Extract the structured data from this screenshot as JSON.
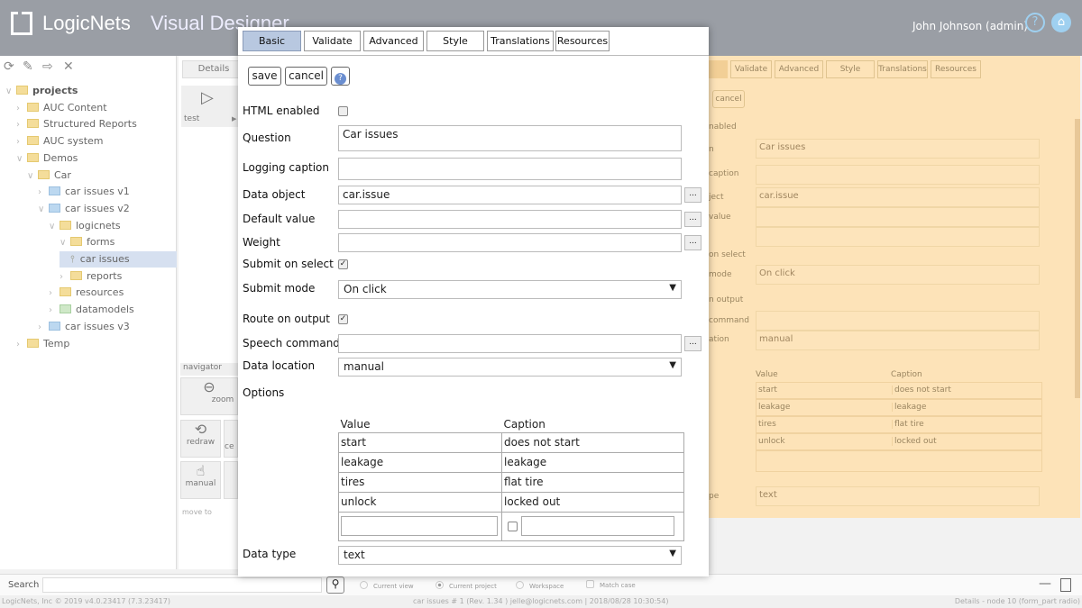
{
  "header": {
    "brand": "LogicNets",
    "subtitle": "Visual Designer",
    "user": "John Johnson (admin)",
    "help_icon": "?",
    "home_icon": "⌂"
  },
  "sidebar": {
    "toolbar_icons": [
      "refresh-icon",
      "edit-icon",
      "export-icon",
      "close-icon"
    ],
    "tree": [
      {
        "label": "projects",
        "level": 0,
        "open": true,
        "color": "yellow",
        "bold": true
      },
      {
        "label": "AUC Content",
        "level": 1,
        "open": false,
        "color": "yellow"
      },
      {
        "label": "Structured Reports",
        "level": 1,
        "open": false,
        "color": "yellow"
      },
      {
        "label": "AUC system",
        "level": 1,
        "open": false,
        "color": "yellow"
      },
      {
        "label": "Demos",
        "level": 1,
        "open": true,
        "color": "yellow"
      },
      {
        "label": "Car",
        "level": 2,
        "open": true,
        "color": "yellow"
      },
      {
        "label": "car issues v1",
        "level": 3,
        "open": false,
        "color": "blue"
      },
      {
        "label": "car issues v2",
        "level": 3,
        "open": true,
        "color": "blue"
      },
      {
        "label": "logicnets",
        "level": 4,
        "open": true,
        "color": "yellow"
      },
      {
        "label": "forms",
        "level": 5,
        "open": true,
        "color": "yellow"
      },
      {
        "label": "car issues",
        "level": 5,
        "leaf": true,
        "selected": true
      },
      {
        "label": "reports",
        "level": 5,
        "open": false,
        "color": "yellow"
      },
      {
        "label": "resources",
        "level": 4,
        "open": false,
        "color": "yellow"
      },
      {
        "label": "datamodels",
        "level": 4,
        "open": false,
        "color": "green"
      },
      {
        "label": "car issues v3",
        "level": 3,
        "open": false,
        "color": "blue"
      },
      {
        "label": "Temp",
        "level": 1,
        "open": false,
        "color": "yellow"
      }
    ]
  },
  "middle": {
    "details_tab": "Details",
    "node_label": "test",
    "navigator": "navigator",
    "zoom": "zoom",
    "redraw": "redraw",
    "center_partial": "ce",
    "manual": "manual",
    "move_to": "move to"
  },
  "dialog": {
    "tabs": [
      "Basic",
      "Validate",
      "Advanced",
      "Style",
      "Translations",
      "Resources"
    ],
    "active_tab": "Basic",
    "save": "save",
    "cancel": "cancel",
    "help": "?",
    "fields": {
      "html_enabled": {
        "label": "HTML enabled",
        "checked": false
      },
      "question": {
        "label": "Question",
        "value": "Car issues"
      },
      "logging_caption": {
        "label": "Logging caption",
        "value": ""
      },
      "data_object": {
        "label": "Data object",
        "value": "car.issue"
      },
      "default_value": {
        "label": "Default value",
        "value": ""
      },
      "weight": {
        "label": "Weight",
        "value": ""
      },
      "submit_on_select": {
        "label": "Submit on select",
        "checked": true
      },
      "submit_mode": {
        "label": "Submit mode",
        "value": "On click"
      },
      "route_on_output": {
        "label": "Route on output",
        "checked": true
      },
      "speech_command": {
        "label": "Speech command",
        "value": ""
      },
      "data_location": {
        "label": "Data location",
        "value": "manual"
      },
      "options": {
        "label": "Options",
        "headers": [
          "Value",
          "Caption"
        ],
        "rows": [
          [
            "start",
            "does not start"
          ],
          [
            "leakage",
            "leakage"
          ],
          [
            "tires",
            "flat tire"
          ],
          [
            "unlock",
            "locked out"
          ]
        ]
      },
      "data_type": {
        "label": "Data type",
        "value": "text"
      }
    },
    "dots": "..."
  },
  "background_panel": {
    "labels": [
      "nabled",
      "n",
      "caption",
      "ject",
      "value",
      "on select",
      "mode",
      "n output",
      "command",
      "ation",
      "pe"
    ]
  },
  "search": {
    "label": "Search",
    "placeholder": "",
    "scopes": [
      "Current view",
      "Current project",
      "Workspace"
    ],
    "selected_scope": "Current project",
    "match_case": "Match case"
  },
  "status": {
    "left": "LogicNets, Inc © 2019 v4.0.23417 (7.3.23417)",
    "center": "car issues # 1 (Rev. 1.34 ) jelle@logicnets.com | 2018/08/28 10:30:54)",
    "right": "Details - node 10 (form_part radio)"
  },
  "colors": {
    "header": "#9a9ea5",
    "active_tab": "#b8c8e0",
    "overlay_panel": "#fde3b8",
    "selection": "#d6e0f0"
  }
}
